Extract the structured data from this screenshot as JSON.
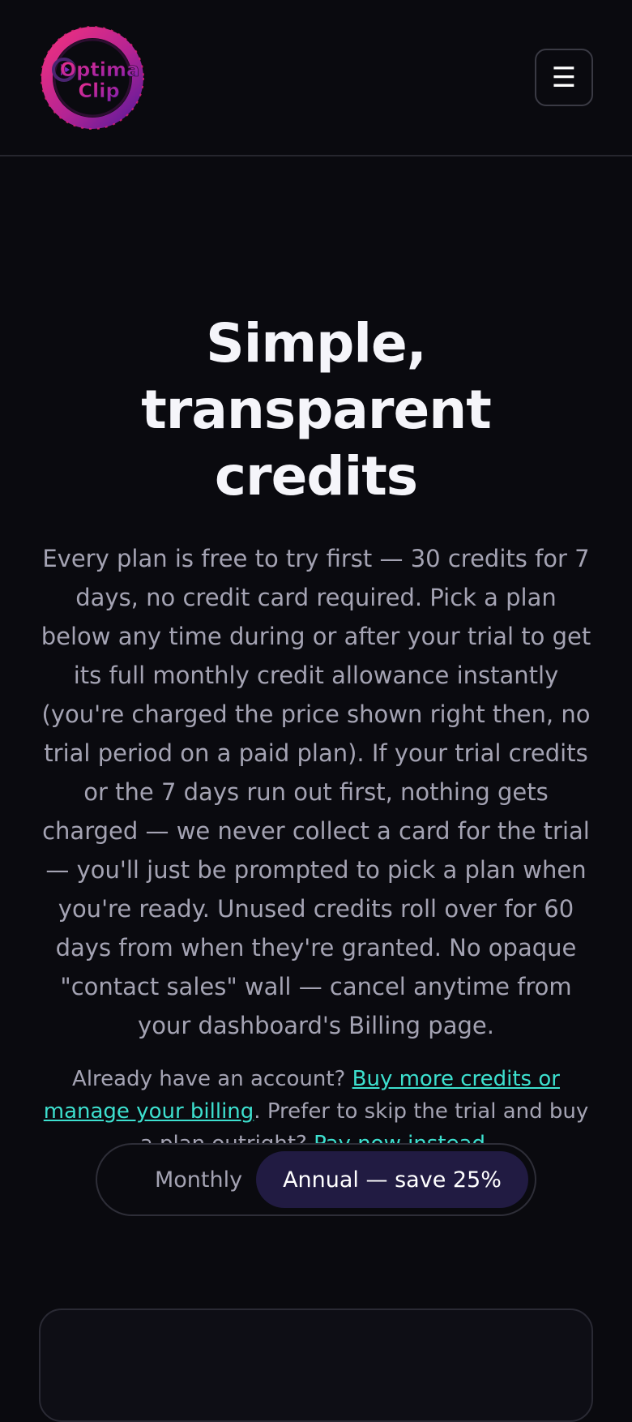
{
  "header": {
    "logo_text_line1": "Optima",
    "logo_text_line2": "Clip",
    "menu_icon": "menu-icon",
    "menu_glyph": "☰"
  },
  "hero": {
    "title": "Simple, transparent credits",
    "description": "Every plan is free to try first — 30 credits for 7 days, no credit card required. Pick a plan below any time during or after your trial to get its full monthly credit allowance instantly (you're charged the price shown right then, no trial period on a paid plan). If your trial credits or the 7 days run out first, nothing gets charged — we never collect a card for the trial — you'll just be prompted to pick a plan when you're ready. Unused credits roll over for 60 days from when they're granted. No opaque \"contact sales\" wall — cancel anytime from your dashboard's Billing page.",
    "note_prefix": "Already have an account? ",
    "note_link1": "Buy more credits or manage your billing",
    "note_middle": ". Prefer to skip the trial and buy a plan outright? ",
    "note_link2": "Pay now instead",
    "note_suffix": "."
  },
  "billing_toggle": {
    "monthly_label": "Monthly",
    "annual_label": "Annual — save 25%",
    "selected": "annual"
  },
  "colors": {
    "background": "#0a0a0f",
    "accent_link": "#3de0cf",
    "toggle_active": "#211b42",
    "logo_pink": "#e0207a",
    "logo_purple": "#6a1fa6"
  }
}
